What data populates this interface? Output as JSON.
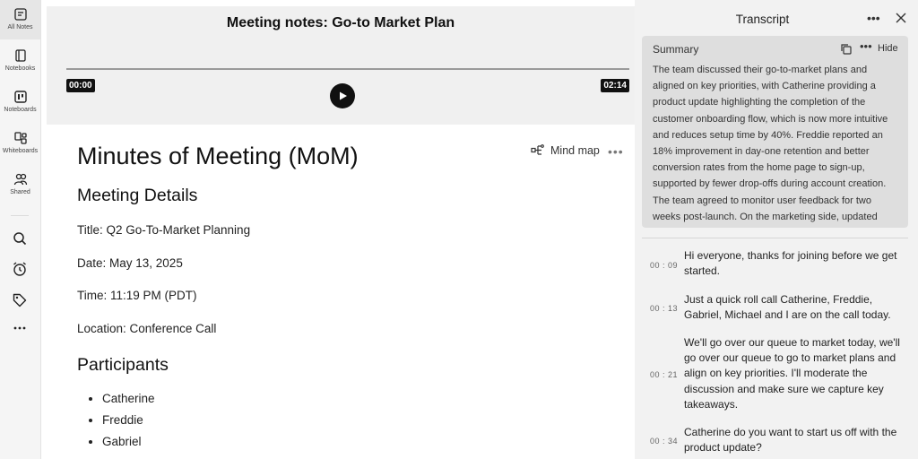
{
  "sidebar": {
    "items": [
      {
        "label": "All Notes",
        "icon": "all-notes-icon"
      },
      {
        "label": "Notebooks",
        "icon": "notebook-icon"
      },
      {
        "label": "Noteboards",
        "icon": "noteboard-icon"
      },
      {
        "label": "Whiteboards",
        "icon": "whiteboard-icon"
      },
      {
        "label": "Shared",
        "icon": "shared-users-icon"
      }
    ],
    "tools": [
      "search-icon",
      "alarm-clock-icon",
      "tag-icon",
      "more-icon"
    ]
  },
  "player": {
    "title": "Meeting notes: Go-to Market Plan",
    "current_time": "00:00",
    "duration": "02:14",
    "progress": 0
  },
  "doc": {
    "title": "Minutes of Meeting (MoM)",
    "mind_map_label": "Mind map",
    "details_heading": "Meeting Details",
    "title_line": "Title: Q2 Go-To-Market Planning",
    "date_line": "Date: May 13, 2025",
    "time_line": "Time: 11:19 PM (PDT)",
    "location_line": "Location: Conference Call",
    "participants_heading": "Participants",
    "participants": [
      "Catherine",
      "Freddie",
      "Gabriel"
    ]
  },
  "transcript": {
    "title": "Transcript",
    "summary": {
      "label": "Summary",
      "hide_label": "Hide",
      "text": "The team discussed their go-to-market plans and aligned on key priorities, with Catherine providing a product update highlighting the completion of the customer onboarding flow, which is now more intuitive and reduces setup time by 40%. Freddie reported an 18% improvement in day-one retention and better conversion rates from the home page to sign-up, supported by fewer drop-offs during account creation. The team agreed to monitor user feedback for two weeks post-launch. On the marketing side, updated"
    },
    "entries": [
      {
        "time": "00 : 09",
        "text": "Hi everyone, thanks for joining before we get started."
      },
      {
        "time": "00 : 13",
        "text": "Just a quick roll call Catherine, Freddie, Gabriel, Michael and I are on the call today."
      },
      {
        "time": "00 : 21",
        "text": "We'll go over our queue to market today, we'll go over our queue to go to market plans and align on key priorities. I'll moderate the discussion and make sure we capture key takeaways."
      },
      {
        "time": "00 : 34",
        "text": "Catherine do you want to start us off with the product update?"
      }
    ]
  }
}
